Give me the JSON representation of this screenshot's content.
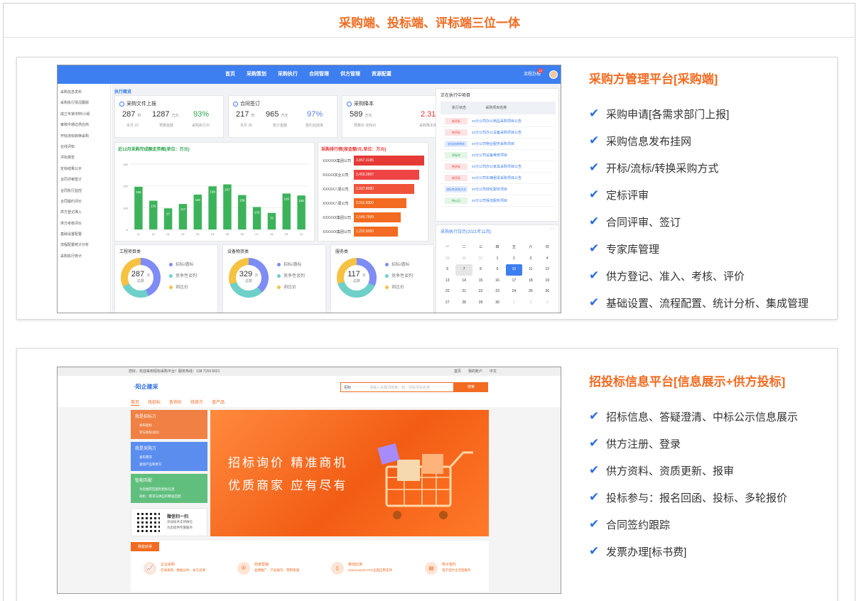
{
  "page": {
    "title": "采购端、投标端、评标端三位一体"
  },
  "section1": {
    "heading": "采购方管理平台[采购端]",
    "features": [
      "采购申请[各需求部门上报]",
      "采购信息发布挂网",
      "开标/流标/转换采购方式",
      "定标评审",
      "合同评审、签订",
      "专家库管理",
      "供方登记、准入、考核、评价",
      "基础设置、流程配置、统计分析、集成管理"
    ]
  },
  "section2": {
    "heading": "招投标信息平台[信息展示+供方投标]",
    "features": [
      "招标信息、答疑澄清、中标公示信息展示",
      "供方注册、登录",
      "供方资料、资质更新、报审",
      "投标参与：报名回函、投标、多轮报价",
      "合同签约跟踪",
      "发票办理[标书费]"
    ]
  },
  "shot1": {
    "nav": [
      "首页",
      "采购策划",
      "采购执行",
      "合同管理",
      "供方管理",
      "资源配置"
    ],
    "top_right": "流程办理",
    "badge": "12",
    "sidebar": [
      "采购信息发布",
      "采购执行情况跟踪",
      "成立专家/材料小组",
      "审核中通过供应商",
      "开标流标转换采购",
      "在线评标",
      "评标报告",
      "定标结果公示",
      "合同评审签订",
      "合同执行监控",
      "合同履约评价",
      "供方登记准入",
      "供方考核评价",
      "基础设置配置",
      "流程配置统计分析",
      "采购执行统计"
    ],
    "section_label": "执行概览",
    "kpis": [
      {
        "title": "采购文件上报",
        "n1": "287",
        "u1": "份",
        "n2": "1287",
        "u2": "万元",
        "pct": "93%",
        "pct_color": "#2ea44f",
        "l1": "本月 22",
        "l2": "预算金额",
        "l3": "采购执行中"
      },
      {
        "title": "合同签订",
        "n1": "217",
        "u1": "份",
        "n2": "965",
        "u2": "万元",
        "pct": "97%",
        "pct_color": "#5b7cf0",
        "l1": "本月 26",
        "l2": "签订金额",
        "l3": "签约完成率"
      },
      {
        "title": "采购降本",
        "n1": "589",
        "u1": "万元",
        "n2": "",
        "u2": "",
        "pct": "2.31%",
        "pct_color": "#e53935",
        "l1": "预算价-定标价",
        "l2": "",
        "l3": "采购降本率"
      }
    ],
    "bar_chart": {
      "title": "近12月采购完成额走势图(单位：万元)"
    },
    "rank": {
      "title": "采购排行榜(按金额/元,单位：万元)",
      "rows": [
        {
          "name": "XXXXXX集团公司",
          "value": "3,867.0185",
          "color": "#e53935",
          "w": 138
        },
        {
          "name": "XXXXX实业公司",
          "value": "3,453.2897",
          "color": "#ef4444",
          "w": 128
        },
        {
          "name": "XXXXX八局公司",
          "value": "2,937.8080",
          "color": "#f0533a",
          "w": 118
        },
        {
          "name": "XXXXX八局公司",
          "value": "2,011.8300",
          "color": "#f26b21",
          "w": 103
        },
        {
          "name": "XXXXXX集团公司",
          "value": "1,545.7509",
          "color": "#f26b21",
          "w": 92
        },
        {
          "name": "XXXXXX集团公司",
          "value": "1,222.5050",
          "color": "#f26b21",
          "w": 86
        }
      ]
    },
    "gauges": [
      {
        "title": "工程项目类",
        "total": "287",
        "unit": "次",
        "label": "总数",
        "items": [
          {
            "name": "招标/邀标",
            "value": "125",
            "color": "#7e8cf5"
          },
          {
            "name": "竞争性谈判",
            "value": "69",
            "color": "#6fcfc9"
          },
          {
            "name": "询比价",
            "value": "93",
            "color": "#f5c242"
          }
        ]
      },
      {
        "title": "设备物资类",
        "total": "329",
        "unit": "次",
        "label": "总数",
        "items": [
          {
            "name": "招标/邀标",
            "value": "125",
            "color": "#7e8cf5"
          },
          {
            "name": "竞争性谈判",
            "value": "104",
            "color": "#6fcfc9"
          },
          {
            "name": "询比价",
            "value": "100",
            "color": "#f5c242"
          }
        ]
      },
      {
        "title": "服务类",
        "total": "117",
        "unit": "次",
        "label": "总数",
        "items": [
          {
            "name": "招标/邀标",
            "value": "37",
            "color": "#7e8cf5"
          },
          {
            "name": "竞争性谈判",
            "value": "45",
            "color": "#6fcfc9"
          },
          {
            "name": "询比价",
            "value": "35",
            "color": "#f5c242"
          }
        ]
      }
    ],
    "projects": {
      "title": "正在执行中项目",
      "head": [
        "执行状态",
        "采购项目名称"
      ],
      "rows": [
        {
          "status": "待开标",
          "name": "xx分公司办公用品采购项目公告",
          "tag": "#fde3e3",
          "tc": "#e53935"
        },
        {
          "status": "待开标",
          "name": "xx分公司办公设备采购项目公告",
          "tag": "#fde3e3",
          "tc": "#e53935"
        },
        {
          "status": "定标结果审核",
          "name": "xx分公司物业服务采购项目",
          "tag": "#e3ecfd",
          "tc": "#3d7ef0"
        },
        {
          "status": "评标中",
          "name": "xx分公司设备维修项目",
          "tag": "#e3f6e6",
          "tc": "#2ea44f"
        },
        {
          "status": "待开标",
          "name": "xx分公司办公家具采购项目公告",
          "tag": "#fde3e3",
          "tc": "#e53935"
        },
        {
          "status": "待开标",
          "name": "xx分公司车辆租赁采购项目公告",
          "tag": "#fde3e3",
          "tc": "#e53935"
        },
        {
          "status": "流标转采购方式",
          "name": "xx分公司绿化服务项目",
          "tag": "#e3ecfd",
          "tc": "#3d7ef0"
        },
        {
          "status": "待公示",
          "name": "xx分公司保洁服务项目",
          "tag": "#e3f6e6",
          "tc": "#2ea44f"
        }
      ]
    },
    "calendar": {
      "title": "采购执行日历(2021年11月)",
      "week": [
        "一",
        "二",
        "三",
        "四",
        "五",
        "六",
        "日"
      ],
      "days": [
        "29",
        "30",
        "31",
        "1",
        "2",
        "3",
        "4",
        "6",
        "7",
        "8",
        "9",
        "10",
        "11",
        "12",
        "13",
        "14",
        "15",
        "16",
        "17",
        "18",
        "19",
        "20",
        "21",
        "22",
        "23",
        "24",
        "25",
        "26",
        "27",
        "28",
        "29",
        "30",
        "1",
        "2",
        "3"
      ],
      "event_today": "开标",
      "event_sel": "定标"
    }
  },
  "shot2": {
    "topbar": "您好，欢迎来到招标采购平台！服务热线：138 7159 6021",
    "topbar_right": [
      "首页",
      "我的账户",
      "中文"
    ],
    "logo": "·阳企建采",
    "search_scope": "招标",
    "search_placeholder": "请输入关键词搜索，如：招标项目名称",
    "search_button": "搜索",
    "tabs": [
      "首页",
      "找招标",
      "查询价",
      "找供方",
      "查产品"
    ],
    "panels": [
      {
        "title": "我是招标方",
        "items": [
          "发布招标",
          "参与投标/竞价"
        ],
        "color": "#f08043"
      },
      {
        "title": "我是采购方",
        "items": [
          "发布需求",
          "查找产品和供方"
        ],
        "color": "#5b8def"
      },
      {
        "title": "智能匹配",
        "items": [
          "为您推荐匹配的招标信息",
          "商机：需求与供应的精准匹配"
        ],
        "color": "#61bf7e"
      }
    ],
    "qr": {
      "title": "微信扫一扫",
      "line1": "添加技术支持微信",
      "line2": "为您提供专属服务"
    },
    "banner": {
      "line1": "招标询价 精准商机",
      "line2": "优质商家 应有尽有"
    },
    "bottom_title": "我能获得",
    "bottom_items": [
      {
        "icon": "📈",
        "title": "企业采购",
        "desc": "在线采购、数据分析、永久追溯"
      },
      {
        "icon": "®",
        "title": "商家营销",
        "desc": "品牌推广、产品展示、营销管理"
      },
      {
        "icon": "▯",
        "title": "移动应用",
        "desc": "HarmonyOS+iOS全面应用支持"
      },
      {
        "icon": "▤",
        "title": "电子签约",
        "desc": "电子签约全流程服务"
      }
    ]
  },
  "chart_data": {
    "type": "bar",
    "title": "近12月采购完成额走势图(单位：万元)",
    "categories": [
      "11",
      "12",
      "01",
      "02",
      "03",
      "04",
      "05",
      "06",
      "07",
      "08",
      "09",
      "10"
    ],
    "values": [
      196,
      132,
      97,
      117,
      160,
      198,
      207,
      158,
      103,
      76,
      165,
      156
    ],
    "ylim": [
      0,
      300
    ],
    "yticks": [
      0,
      100,
      200,
      300
    ],
    "ylabel": "",
    "xlabel": "",
    "color": "#3cb35a"
  }
}
